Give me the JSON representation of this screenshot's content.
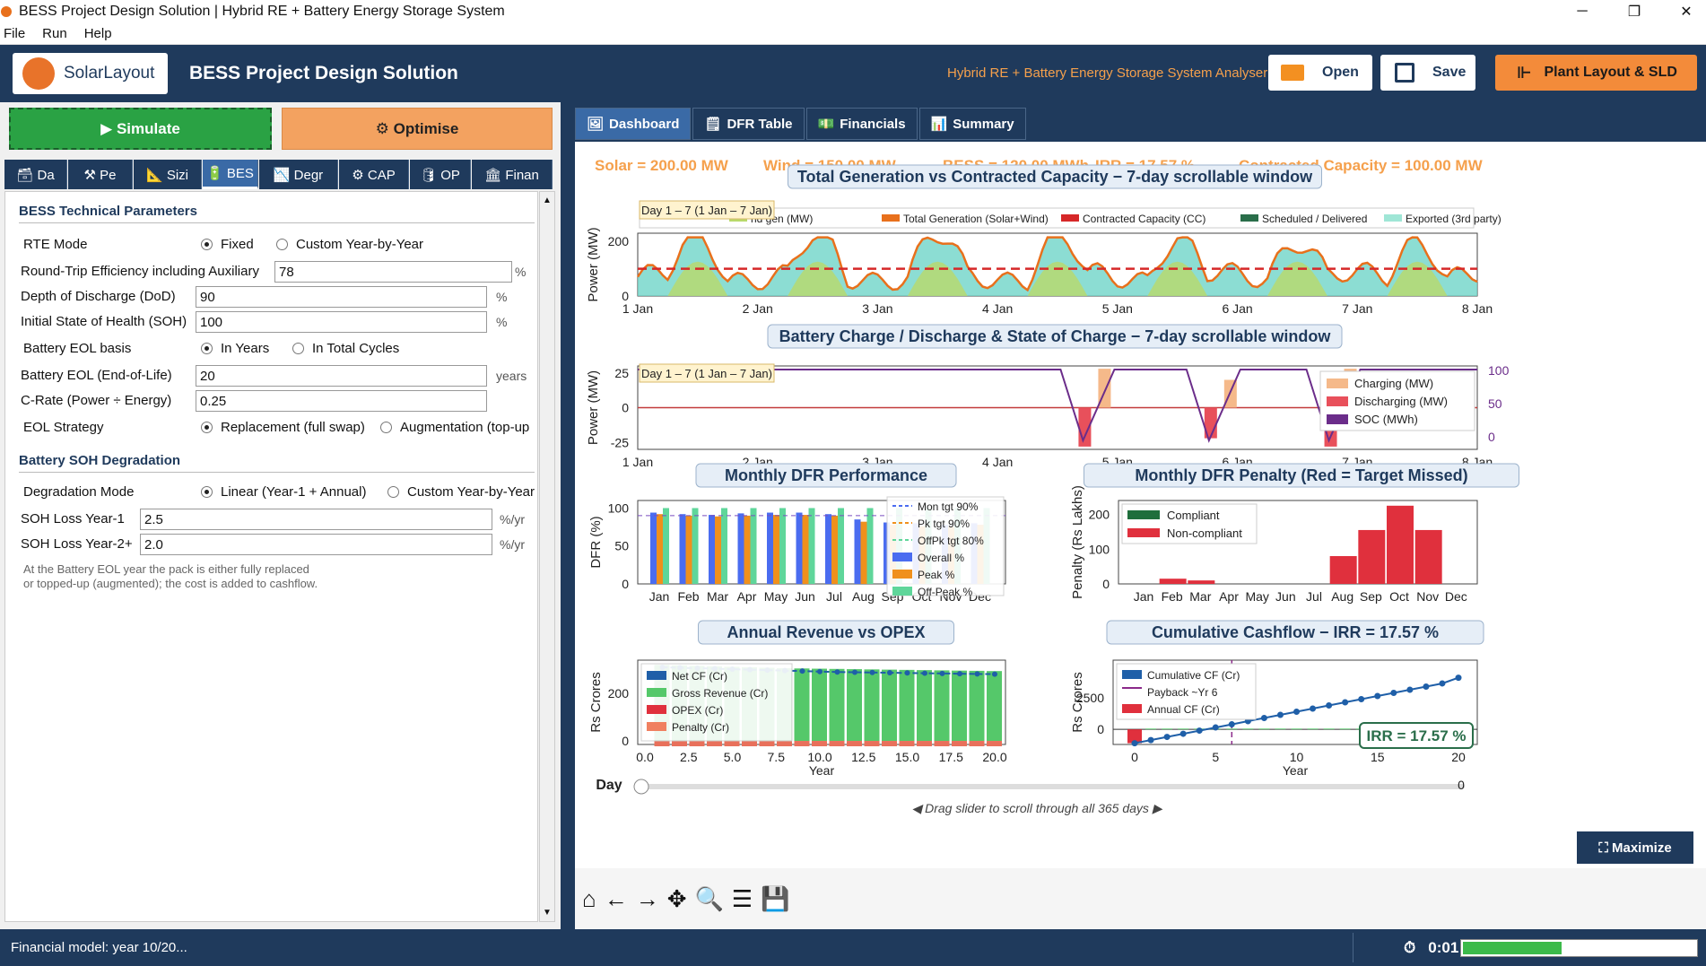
{
  "window": {
    "title": "BESS Project Design Solution   |   Hybrid RE + Battery Energy Storage System",
    "minimize": "─",
    "maximize": "❐",
    "close": "✕"
  },
  "menu": [
    "File",
    "Run",
    "Help"
  ],
  "header": {
    "logo_text": "SolarLayout",
    "title": "BESS Project Design Solution",
    "subtitle": "Hybrid RE + Battery Energy Storage System Analyser",
    "open_label": "Open",
    "save_label": "Save",
    "plant_label": "Plant Layout & SLD",
    "accent": "#f38b3a",
    "brand": "#1f3a5c"
  },
  "left": {
    "simulate_label": "▶  Simulate",
    "optimise_label": "⚙  Optimise",
    "tabs": [
      "🗃 Da",
      "⚒ Pe",
      "📐 Sizi",
      "🔋 BES",
      "📉 Degr",
      "⚙ CAP",
      "🛢 OP",
      "🏛 Finan"
    ],
    "section1": "BESS Technical Parameters",
    "rte_mode_label": "RTE Mode",
    "rte_opt1": "Fixed",
    "rte_opt2": "Custom Year-by-Year",
    "rte_label": "Round-Trip Efficiency including Auxiliary",
    "rte_value": "78",
    "rte_unit": "%",
    "dod_label": "Depth of Discharge (DoD)",
    "dod_value": "90",
    "dod_unit": "%",
    "soh_label": "Initial State of Health (SOH)",
    "soh_value": "100",
    "soh_unit": "%",
    "eolbasis_label": "Battery EOL basis",
    "eol_opt1": "In Years",
    "eol_opt2": "In Total Cycles",
    "eol_label": "Battery EOL (End-of-Life)",
    "eol_value": "20",
    "eol_unit": "years",
    "crate_label": "C-Rate  (Power ÷ Energy)",
    "crate_value": "0.25",
    "strategy_label": "EOL Strategy",
    "strat_opt1": "Replacement (full swap)",
    "strat_opt2": "Augmentation (top-up",
    "section2": "Battery SOH Degradation",
    "deg_label": "Degradation Mode",
    "deg_opt1": "Linear (Year-1 + Annual)",
    "deg_opt2": "Custom Year-by-Year",
    "loss1_label": "SOH Loss Year-1",
    "loss1_value": "2.5",
    "loss1_unit": "%/yr",
    "loss2_label": "SOH Loss Year-2+",
    "loss2_value": "2.0",
    "loss2_unit": "%/yr",
    "note1": "At the Battery EOL year the pack is either fully replaced",
    "note2": "or topped-up (augmented); the cost is added to cashflow."
  },
  "right": {
    "tabs": [
      "Dashboard",
      "DFR Table",
      "Financials",
      "Summary"
    ],
    "maximize_label": "⛶  Maximize",
    "slider_hint": "◀  Drag slider to scroll through all 365 days  ▶",
    "slider_label": "Day",
    "slider_value": "0"
  },
  "chart_data": [
    {
      "type": "area",
      "title": "Total Generation vs Contracted Capacity  −  7-day scrollable window",
      "banner": [
        "Solar = 200.00 MW",
        "Wind = 150.00 MW",
        "BESS = 120.00 MWh",
        "IRR = 17.57 %",
        "Contracted Capacity = 100.00 MW"
      ],
      "window_label": "Day 1 – 7   (1 Jan – 7 Jan)",
      "ylabel": "Power (MW)",
      "ylim": [
        0,
        230
      ],
      "yticks": [
        0,
        200
      ],
      "xticks": [
        "1 Jan",
        "2 Jan",
        "3 Jan",
        "4 Jan",
        "5 Jan",
        "6 Jan",
        "7 Jan",
        "8 Jan"
      ],
      "legend": [
        "nd gen (MW)",
        "Total Generation (Solar+Wind)",
        "Contracted Capacity (CC)",
        "Scheduled / Delivered",
        "Exported (3rd party)"
      ],
      "contracted": 100
    },
    {
      "type": "bar",
      "title": "Battery Charge / Discharge & State of Charge  −  7-day scrollable window",
      "window_label": "Day 1 – 7   (1 Jan – 7 Jan)",
      "ylabel": "Power (MW)",
      "yticks": [
        25,
        0,
        -25
      ],
      "yticks_right": [
        100,
        50,
        0
      ],
      "xticks": [
        "1 Jan",
        "2 Jan",
        "3 Jan",
        "4 Jan",
        "5 Jan",
        "6 Jan",
        "7 Jan",
        "8 Jan"
      ],
      "legend": [
        "Charging (MW)",
        "Discharging (MW)",
        "SOC (MWh)"
      ],
      "events": [
        {
          "day": 3.75,
          "discharge": -28,
          "charge": 28
        },
        {
          "day": 4.8,
          "discharge": -22,
          "charge": 20
        },
        {
          "day": 5.8,
          "discharge": -28,
          "charge": 28
        }
      ]
    },
    {
      "type": "bar",
      "title": "Monthly DFR Performance",
      "ylabel": "DFR (%)",
      "ylim": [
        0,
        110
      ],
      "yticks": [
        0,
        50,
        100
      ],
      "categories": [
        "Jan",
        "Feb",
        "Mar",
        "Apr",
        "May",
        "Jun",
        "Jul",
        "Aug",
        "Sep",
        "Oct",
        "Nov",
        "Dec"
      ],
      "legend": [
        "Mon tgt 90%",
        "Pk tgt 90%",
        "OffPk tgt 80%",
        "Overall %",
        "Peak %",
        "Off-Peak %"
      ],
      "series": [
        {
          "name": "Overall %",
          "values": [
            94,
            92,
            91,
            93,
            94,
            94,
            92,
            85,
            81,
            80,
            78,
            80
          ]
        },
        {
          "name": "Peak %",
          "values": [
            92,
            90,
            89,
            90,
            91,
            91,
            90,
            82,
            78,
            76,
            75,
            78
          ]
        },
        {
          "name": "Off-Peak %",
          "values": [
            100,
            100,
            100,
            100,
            100,
            100,
            100,
            100,
            100,
            100,
            100,
            100
          ]
        }
      ]
    },
    {
      "type": "bar",
      "title": "Monthly DFR Penalty  (Red = Target Missed)",
      "ylabel": "Penalty (Rs Lakhs)",
      "ylim": [
        0,
        240
      ],
      "yticks": [
        0,
        100,
        200
      ],
      "categories": [
        "Jan",
        "Feb",
        "Mar",
        "Apr",
        "May",
        "Jun",
        "Jul",
        "Aug",
        "Sep",
        "Oct",
        "Nov",
        "Dec"
      ],
      "legend": [
        "Compliant",
        "Non-compliant"
      ],
      "values": [
        0,
        15,
        10,
        0,
        0,
        0,
        0,
        80,
        155,
        225,
        155,
        0
      ]
    },
    {
      "type": "bar",
      "title": "Annual Revenue vs OPEX",
      "ylabel": "Rs Crores",
      "xlabel": "Year",
      "ylim": [
        -15,
        340
      ],
      "yticks": [
        0,
        200
      ],
      "xticks": [
        "0.0",
        "2.5",
        "5.0",
        "7.5",
        "10.0",
        "12.5",
        "15.0",
        "17.5",
        "20.0"
      ],
      "legend": [
        "Net CF (Cr)",
        "Gross Revenue (Cr)",
        "OPEX (Cr)",
        "Penalty (Cr)"
      ],
      "gross_revenue": [
        320,
        318,
        316,
        314,
        312,
        310,
        308,
        306,
        305,
        304,
        303,
        302,
        301,
        300,
        299,
        298,
        297,
        296,
        295,
        294
      ],
      "net_cf": [
        310,
        308,
        306,
        304,
        302,
        300,
        298,
        296,
        294,
        292,
        290,
        289,
        288,
        287,
        286,
        285,
        284,
        283,
        282,
        281
      ]
    },
    {
      "type": "line",
      "title": "Cumulative Cashflow  −  IRR = 17.57 %",
      "ylabel": "Rs Crores",
      "xlabel": "Year",
      "ylim": [
        -1200,
        5500
      ],
      "yticks": [
        0,
        2500
      ],
      "xticks": [
        "0",
        "5",
        "10",
        "15",
        "20"
      ],
      "legend": [
        "Cumulative CF (Cr)",
        "Payback ~Yr 6",
        "Annual CF (Cr)"
      ],
      "annotation": "IRR = 17.57 %",
      "cumulative": [
        -1100,
        -850,
        -600,
        -350,
        -100,
        150,
        400,
        650,
        900,
        1150,
        1400,
        1650,
        1900,
        2150,
        2400,
        2650,
        2900,
        3150,
        3400,
        3650,
        4100
      ],
      "payback_year": 6
    }
  ],
  "status": {
    "message": "Financial model: year 10/20...",
    "timer": "0:01",
    "timer_icon": "⏱",
    "progress": 0.42
  }
}
